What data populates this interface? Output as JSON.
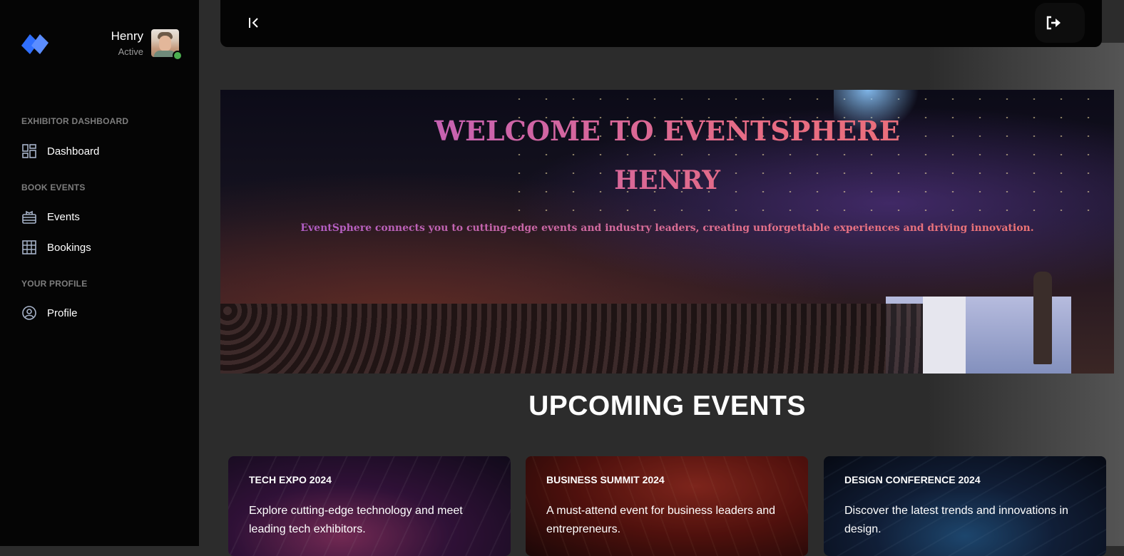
{
  "user": {
    "name": "Henry",
    "status": "Active"
  },
  "sidebar": {
    "sections": [
      {
        "title": "EXHIBITOR DASHBOARD",
        "items": [
          {
            "label": "Dashboard",
            "icon": "dashboard-icon"
          }
        ]
      },
      {
        "title": "BOOK EVENTS",
        "items": [
          {
            "label": "Events",
            "icon": "events-icon"
          },
          {
            "label": "Bookings",
            "icon": "bookings-grid-icon"
          }
        ]
      },
      {
        "title": "YOUR PROFILE",
        "items": [
          {
            "label": "Profile",
            "icon": "profile-icon"
          }
        ]
      }
    ]
  },
  "topbar": {
    "collapse_icon": "collapse-sidebar-icon",
    "logout_icon": "logout-icon"
  },
  "hero": {
    "title_line1": "WELCOME TO EVENTSPHERE",
    "title_line2": "HENRY",
    "subtitle": "EventSphere connects you to cutting-edge events and industry leaders, creating unforgettable experiences and driving innovation."
  },
  "upcoming": {
    "heading": "UPCOMING EVENTS",
    "events": [
      {
        "title": "TECH EXPO 2024",
        "description": "Explore cutting-edge technology and meet leading tech exhibitors."
      },
      {
        "title": "BUSINESS SUMMIT 2024",
        "description": "A must-attend event for business leaders and entrepreneurs."
      },
      {
        "title": "DESIGN CONFERENCE 2024",
        "description": "Discover the latest trends and innovations in design."
      }
    ]
  },
  "colors": {
    "sidebar_bg": "#050505",
    "page_bg": "#2c2c2c",
    "accent_blue": "#3b82f6",
    "online": "#4caf50",
    "hero_gradient_start": "#b05ad0",
    "hero_gradient_end": "#f0736d"
  }
}
